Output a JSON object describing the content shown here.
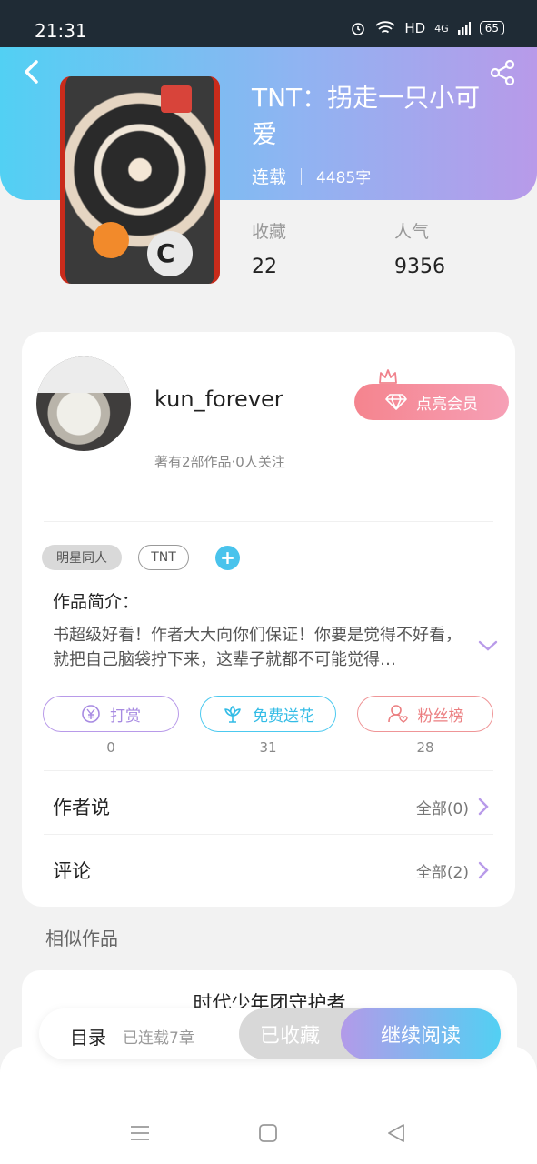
{
  "status_bar": {
    "time": "21:31",
    "network": "HD",
    "signal_label": "4G",
    "battery": "65"
  },
  "book": {
    "title": "TNT：拐走一只小可爱",
    "status": "连载",
    "word_count": "4485字",
    "stats": [
      {
        "label": "收藏",
        "value": "22"
      },
      {
        "label": "人气",
        "value": "9356"
      }
    ],
    "cover_letter": "C"
  },
  "author": {
    "name": "kun_forever",
    "summary": "著有2部作品·0人关注",
    "vip_label": "点亮会员"
  },
  "tags": {
    "items": [
      "明星同人",
      "TNT"
    ],
    "add_label": "+"
  },
  "intro": {
    "title": "作品简介：",
    "text": "书超级好看！作者大大向你们保证！你要是觉得不好看，就把自己脑袋拧下来，这辈子就都不可能觉得…"
  },
  "actions": [
    {
      "label": "打赏",
      "count": "0"
    },
    {
      "label": "免费送花",
      "count": "31"
    },
    {
      "label": "粉丝榜",
      "count": "28"
    }
  ],
  "rows": [
    {
      "label": "作者说",
      "value": "全部(0)"
    },
    {
      "label": "评论",
      "value": "全部(2)"
    }
  ],
  "similar": {
    "title": "相似作品",
    "first_book": "时代少年团守护者"
  },
  "bottom_bar": {
    "toc_label": "目录",
    "toc_sub": "已连载7章",
    "collected_label": "已收藏",
    "read_label": "继续阅读"
  },
  "colors": {
    "accent_blue": "#52d0f3",
    "accent_purple": "#b89ae9",
    "vip_pink": "#f5848e"
  },
  "icons": [
    "back-icon",
    "share-icon",
    "crown-icon",
    "diamond-icon",
    "yen-icon",
    "flower-icon",
    "fans-icon",
    "chevron-right-icon",
    "chevron-down-icon",
    "menu-icon",
    "home-icon",
    "back-nav-icon"
  ]
}
